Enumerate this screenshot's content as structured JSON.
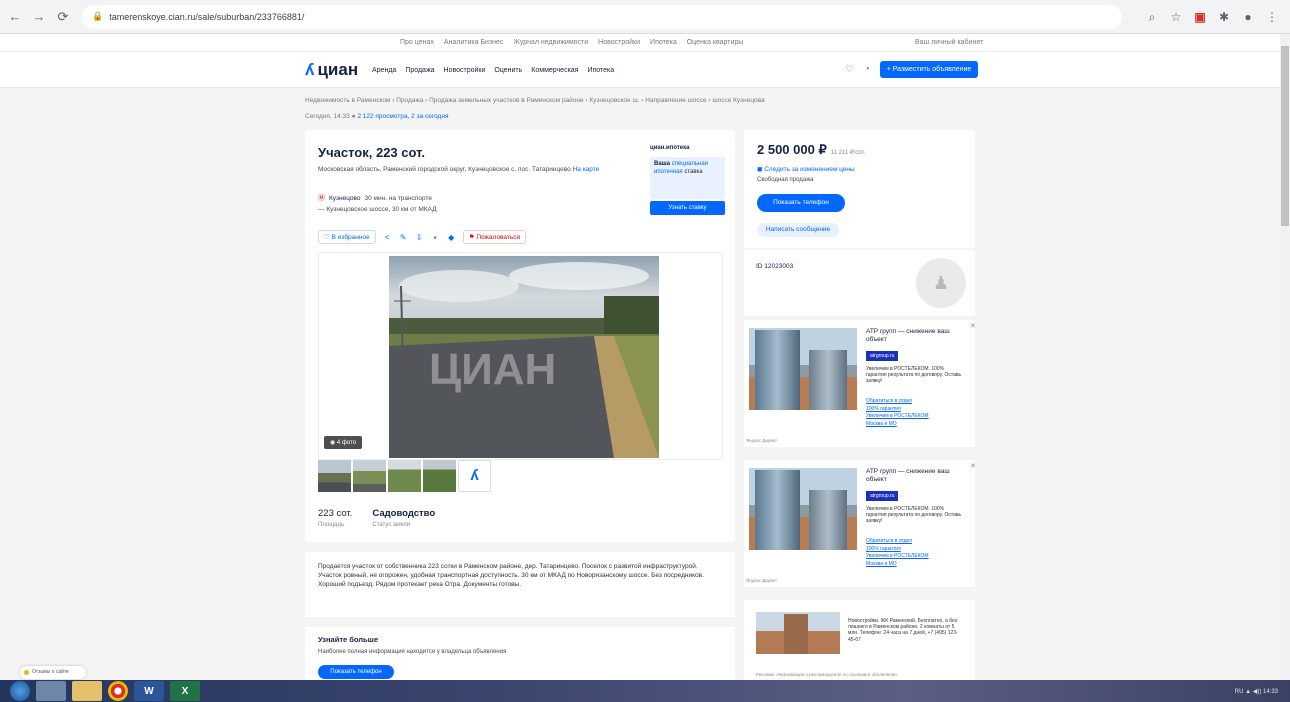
{
  "browser": {
    "url": "tamerenskoye.cian.ru/sale/suburban/233766881/",
    "extensions": [
      "search-icon",
      "star-icon",
      "ext-icon",
      "puzzle-icon",
      "profile-icon",
      "menu-icon"
    ]
  },
  "site_topline": {
    "links": [
      "Про ценах",
      "Аналитика Бизнес",
      "Журнал недвижимости",
      "Новостройки",
      "Ипотека",
      "Оценка квартиры"
    ],
    "region": "Ваш личный кабинет"
  },
  "header": {
    "logo_text": "циан",
    "nav": [
      "Аренда",
      "Продажа",
      "Новостройки",
      "Оценить",
      "Коммерческая",
      "Ипотека"
    ],
    "place_button": "+ Разместить объявление"
  },
  "breadcrumb": "Недвижимость в Раменском › Продажа › Продажа земельных участков в Раменском районе › Кузнецовское ш. › Направление шоссе › шоссе Кузнецова",
  "meta": {
    "date": "Сегодня, 14:33",
    "views": "2 122 просмотра, 2 за сегодня"
  },
  "listing": {
    "title": "Участок, 223 сот.",
    "address": "Московская область, Раменский городской округ, Кузнецовское с. пос. Татаринцево",
    "map_link": "На карте",
    "metro_name": "Кузнецово",
    "metro_time": "30 мин. на транспорте",
    "highway": "Кузнецовское шоссе, 30 км от МКАД",
    "actions": {
      "favorite": "В избранное",
      "complaint": "Пожаловаться"
    },
    "photo_count": "4 фото",
    "area_value": "223 сот.",
    "area_caption": "Площадь",
    "status_value": "Садоводство",
    "status_caption": "Статус земли",
    "description": "Продается участок от собственника 223 сотки в Раменском районе, дер. Татаринцево. Поселок с развитой инфраструктурой. Участок ровный, не огорожен, удобная транспортная доступность. 30 км от МКАД по Новорязанскому шоссе. Без посредников. Хороший подъезд. Рядом протекает река Отра. Документы готовы.",
    "learn_title": "Узнайте больше",
    "learn_text": "Наиболее полная информация находится у владельца объявления",
    "learn_button": "Показать телефон"
  },
  "promo": {
    "brand": "циан.ипотека",
    "text_prefix": "Ваша",
    "text_highlight": "специальная ипотечная",
    "text_suffix": "ставка",
    "button": "Узнать ставку"
  },
  "price_card": {
    "price": "2 500 000 ₽",
    "per_unit": "11 211 ₽/сот.",
    "watch": "Следить за изменением цены",
    "note": "Свободная продажа",
    "phone_button": "Показать телефон",
    "message_button": "Написать сообщение"
  },
  "owner": {
    "id_label": "ID 12023003"
  },
  "ads": [
    {
      "title": "АТР групп — снижение ваш объект",
      "badge": "atrgroup.ru",
      "text": "Увеличим в РОСТЕЛЕКОМ. 100% гарантия результата по договору. Оставь заявку!",
      "links": [
        "Обратиться в отдел",
        "100% гарантия",
        "Увеличим в РОСТЕЛЕКОМ",
        "Москва и МО"
      ],
      "source": "Яндекс.Директ"
    },
    {
      "title": "АТР групп — снижение ваш объект",
      "badge": "atrgroup.ru",
      "text": "Увеличим в РОСТЕЛЕКОМ. 100% гарантия результата по договору. Оставь заявку!",
      "links": [
        "Обратиться в отдел",
        "100% гарантия",
        "Увеличим в РОСТЕЛЕКОМ",
        "Москва и МО"
      ],
      "source": "Яндекс.Директ"
    }
  ],
  "ad3": {
    "text": "Новостройки. ЖК Раменский. Бесплатно, а без лишнего в Раменском районе. 2 комнаты от 5 млн. Телефон: 24 часа на 7 дней, +7 (495) 123-45-67",
    "footer": "Реклама. Информация о рекламодателе по ссылкам в объявлении"
  },
  "chat_widget": "Отзывы о сайте",
  "taskbar": {
    "tray_text": "RU ▲ ◀)) 14:33"
  }
}
